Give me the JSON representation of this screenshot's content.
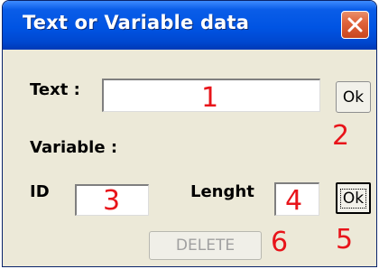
{
  "window": {
    "title": "Text or Variable data"
  },
  "text_row": {
    "label": "Text :",
    "value": "",
    "ok_label": "Ok"
  },
  "variable_section": {
    "label": "Variable :"
  },
  "id_field": {
    "label": "ID",
    "value": ""
  },
  "length_field": {
    "label": "Lenght",
    "value": ""
  },
  "variable_ok_label": "Ok",
  "delete_label": "DELETE",
  "markers": [
    "1",
    "2",
    "3",
    "4",
    "5",
    "6"
  ],
  "colors": {
    "titlebar": "#0054e3",
    "window_bg": "#ece9d8",
    "marker_red": "#e8141a",
    "close_button": "#e0643c"
  }
}
